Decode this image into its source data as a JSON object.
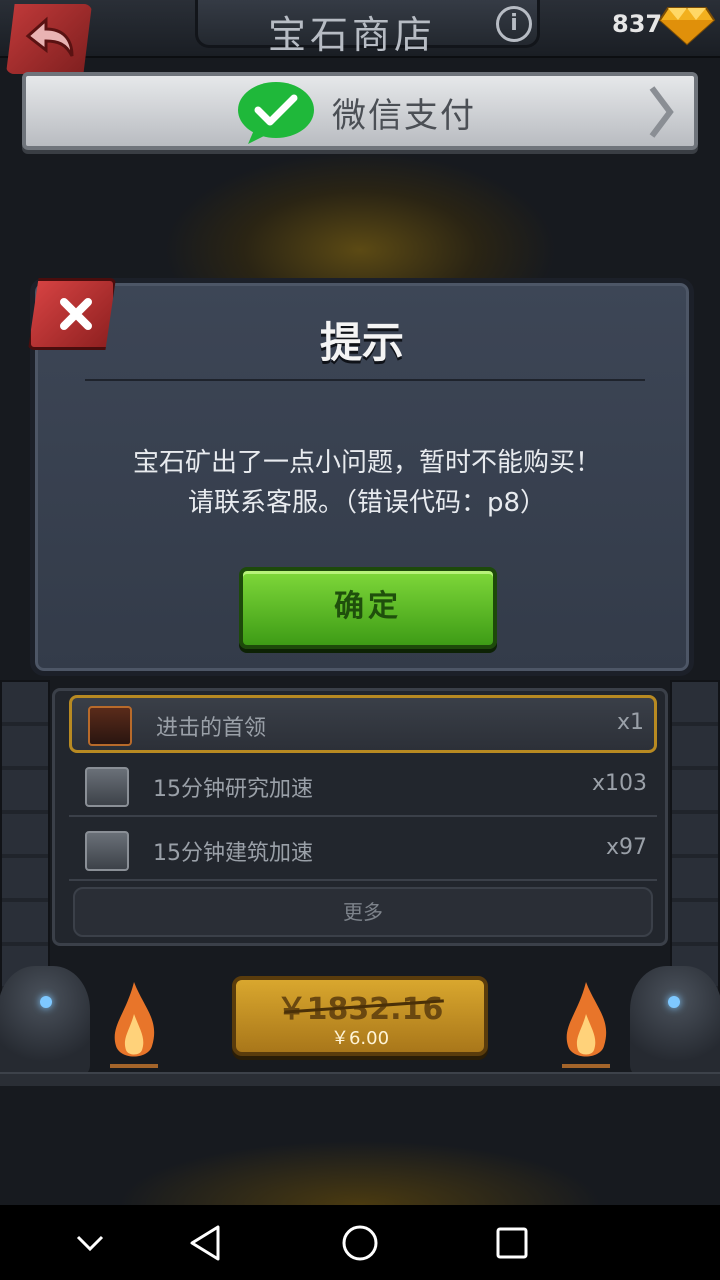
{
  "header": {
    "title": "宝石商店",
    "gem_count": "837"
  },
  "payment": {
    "method_label": "微信支付"
  },
  "dialog": {
    "title": "提示",
    "message_line1": "宝石矿出了一点小问题，暂时不能购买！",
    "message_line2": "请联系客服。（错误代码：p8）",
    "confirm_label": "确定"
  },
  "items": [
    {
      "name": "进击的首领",
      "qty": "x1",
      "icon": "chest-icon"
    },
    {
      "name": "15分钟研究加速",
      "qty": "x103",
      "icon": "research-speedup-icon"
    },
    {
      "name": "15分钟建筑加速",
      "qty": "x97",
      "icon": "build-speedup-icon"
    }
  ],
  "more_label": "更多",
  "price": {
    "original": "￥1832.16",
    "current": "￥6.00"
  },
  "colors": {
    "confirm_green": "#5fbf26",
    "close_red": "#c23a3a",
    "price_gold": "#d9a72e"
  }
}
